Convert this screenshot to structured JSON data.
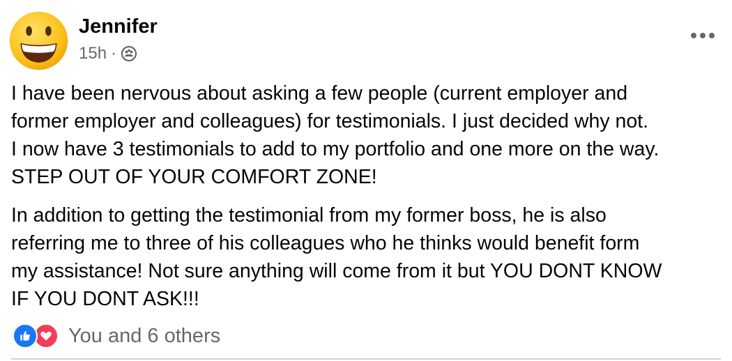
{
  "post": {
    "author": "Jennifer",
    "timestamp": "15h",
    "separator": "·",
    "audience_icon": "friends-icon",
    "avatar_icon": "grinning-face-emoji",
    "more_icon": "more-horizontal-icon",
    "paragraphs": [
      "I have been nervous about asking a few people (current employer and\nformer employer and colleagues) for testimonials.  I just decided why not.\nI now have 3 testimonials  to add to my portfolio and one more on the way.\nSTEP OUT OF YOUR COMFORT ZONE!",
      "In addition to getting the testimonial from my former boss, he is also\nreferring me to three of his colleagues who he thinks would benefit form\nmy assistance!  Not sure anything will come from it but YOU DONT KNOW\nIF YOU DONT ASK!!!"
    ]
  },
  "reactions": {
    "icons": [
      "like-icon",
      "love-icon"
    ],
    "summary": "You and 6 others"
  },
  "colors": {
    "text": "#050505",
    "secondary": "#65676b",
    "like": "#1877f2",
    "love": "#f33e58",
    "divider": "#ced0d4"
  }
}
